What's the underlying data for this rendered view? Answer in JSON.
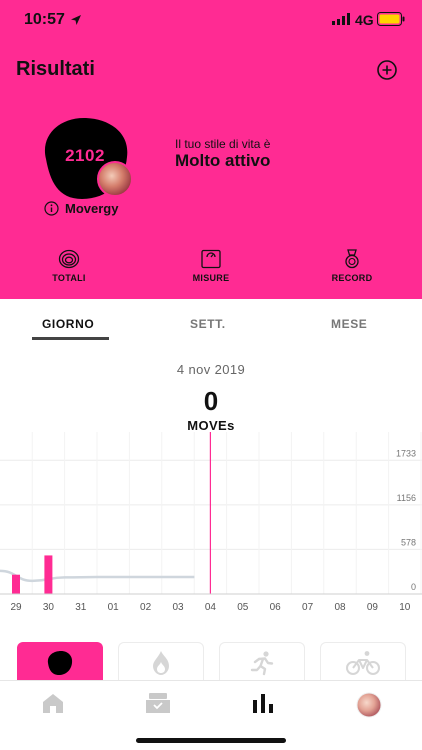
{
  "status_bar": {
    "time": "10:57",
    "network": "4G"
  },
  "header": {
    "title": "Risultati"
  },
  "profile": {
    "score": "2102",
    "info_label": "Movergy",
    "lifestyle_caption": "Il tuo stile di vita è",
    "lifestyle_value": "Molto attivo"
  },
  "quick_nav": [
    {
      "label": "TOTALI",
      "icon": "spiral-icon"
    },
    {
      "label": "MISURE",
      "icon": "scale-icon"
    },
    {
      "label": "RECORD",
      "icon": "medal-icon"
    }
  ],
  "period_tabs": [
    {
      "label": "GIORNO",
      "active": true
    },
    {
      "label": "SETT.",
      "active": false
    },
    {
      "label": "MESE",
      "active": false
    }
  ],
  "day_summary": {
    "date": "4 nov 2019",
    "value": "0",
    "unit": "MOVEs"
  },
  "chart_data": {
    "type": "bar",
    "categories": [
      "29",
      "30",
      "31",
      "01",
      "02",
      "03",
      "04",
      "05",
      "06",
      "07",
      "08",
      "09",
      "10"
    ],
    "series": [
      {
        "type": "bar",
        "values": [
          250,
          500,
          0,
          0,
          0,
          0,
          0,
          null,
          null,
          null,
          null,
          null,
          null
        ]
      },
      {
        "type": "line",
        "values": [
          300,
          170,
          215,
          220,
          220,
          220,
          220,
          null,
          null,
          null,
          null,
          null,
          null
        ]
      }
    ],
    "y_ticks": [
      "1733",
      "1156",
      "578",
      "0"
    ],
    "ylim": [
      0,
      2100
    ],
    "selected_category": "04",
    "colors": {
      "bar": "#ff2b93",
      "line": "#cfd6dd",
      "marker": "#ff2b93",
      "grid": "#ececec"
    }
  },
  "activity_types": [
    {
      "icon": "blob-icon",
      "active": true
    },
    {
      "icon": "flame-icon",
      "active": false
    },
    {
      "icon": "running-icon",
      "active": false
    },
    {
      "icon": "cycling-icon",
      "active": false
    }
  ],
  "tab_bar": [
    {
      "icon": "home-icon"
    },
    {
      "icon": "inbox-icon"
    },
    {
      "icon": "stats-icon",
      "active": true
    },
    {
      "icon": "profile-icon"
    }
  ],
  "colors": {
    "accent": "#ff2b93",
    "text": "#111111",
    "muted": "#777777"
  }
}
